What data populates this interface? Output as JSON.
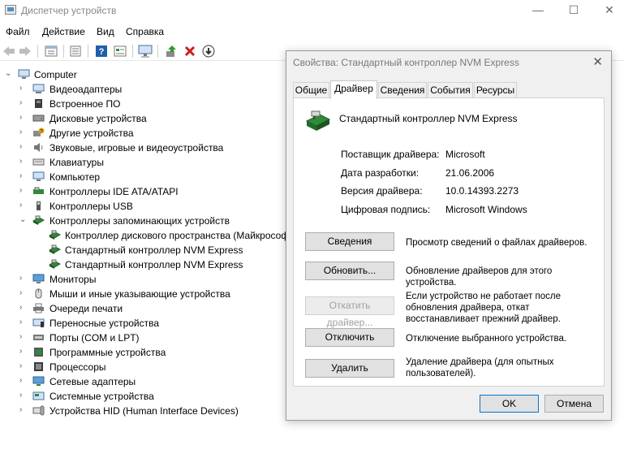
{
  "window": {
    "title": "Диспетчер устройств",
    "minimize": "—",
    "maximize": "☐",
    "close": "✕"
  },
  "menu": [
    "Файл",
    "Действие",
    "Вид",
    "Справка"
  ],
  "tree": {
    "root": "Computer",
    "items": [
      {
        "label": "Видеоадаптеры",
        "icon": "display-adapter-icon"
      },
      {
        "label": "Встроенное ПО",
        "icon": "firmware-icon"
      },
      {
        "label": "Дисковые устройства",
        "icon": "disk-drive-icon"
      },
      {
        "label": "Другие устройства",
        "icon": "other-device-icon"
      },
      {
        "label": "Звуковые, игровые и видеоустройства",
        "icon": "speaker-icon"
      },
      {
        "label": "Клавиатуры",
        "icon": "keyboard-icon"
      },
      {
        "label": "Компьютер",
        "icon": "computer-icon"
      },
      {
        "label": "Контроллеры IDE ATA/ATAPI",
        "icon": "ide-controller-icon"
      },
      {
        "label": "Контроллеры USB",
        "icon": "usb-icon"
      },
      {
        "label": "Контроллеры запоминающих устройств",
        "icon": "storage-controller-icon",
        "expanded": true
      },
      {
        "label": "Контроллер дискового пространства (Майкрософт)",
        "icon": "storage-controller-icon",
        "child": true
      },
      {
        "label": "Стандартный контроллер NVM Express",
        "icon": "storage-controller-icon",
        "child": true
      },
      {
        "label": "Стандартный контроллер NVM Express",
        "icon": "storage-controller-icon",
        "child": true
      },
      {
        "label": "Мониторы",
        "icon": "monitor-icon"
      },
      {
        "label": "Мыши и иные указывающие устройства",
        "icon": "mouse-icon"
      },
      {
        "label": "Очереди печати",
        "icon": "printer-icon"
      },
      {
        "label": "Переносные устройства",
        "icon": "portable-device-icon"
      },
      {
        "label": "Порты (COM и LPT)",
        "icon": "port-icon"
      },
      {
        "label": "Программные устройства",
        "icon": "software-device-icon"
      },
      {
        "label": "Процессоры",
        "icon": "processor-icon"
      },
      {
        "label": "Сетевые адаптеры",
        "icon": "network-adapter-icon"
      },
      {
        "label": "Системные устройства",
        "icon": "system-device-icon"
      },
      {
        "label": "Устройства HID (Human Interface Devices)",
        "icon": "hid-icon"
      }
    ]
  },
  "dialog": {
    "title": "Свойства: Стандартный контроллер NVM Express",
    "close": "✕",
    "tabs": [
      "Общие",
      "Драйвер",
      "Сведения",
      "События",
      "Ресурсы"
    ],
    "active_tab": "Драйвер",
    "device_name": "Стандартный контроллер NVM Express",
    "props": [
      {
        "label": "Поставщик драйвера:",
        "value": "Microsoft"
      },
      {
        "label": "Дата разработки:",
        "value": "21.06.2006"
      },
      {
        "label": "Версия драйвера:",
        "value": "10.0.14393.2273"
      },
      {
        "label": "Цифровая подпись:",
        "value": "Microsoft Windows"
      }
    ],
    "actions": [
      {
        "button": "Сведения",
        "desc": "Просмотр сведений о файлах драйверов."
      },
      {
        "button": "Обновить...",
        "desc": "Обновление драйверов для этого устройства."
      },
      {
        "button": "Откатить драйвер...",
        "desc": "Если устройство не работает после обновления драйвера, откат восстанавливает прежний драйвер.",
        "disabled": true
      },
      {
        "button": "Отключить",
        "desc": "Отключение выбранного устройства."
      },
      {
        "button": "Удалить",
        "desc": "Удаление драйвера (для опытных пользователей)."
      }
    ],
    "ok": "OK",
    "cancel": "Отмена"
  }
}
